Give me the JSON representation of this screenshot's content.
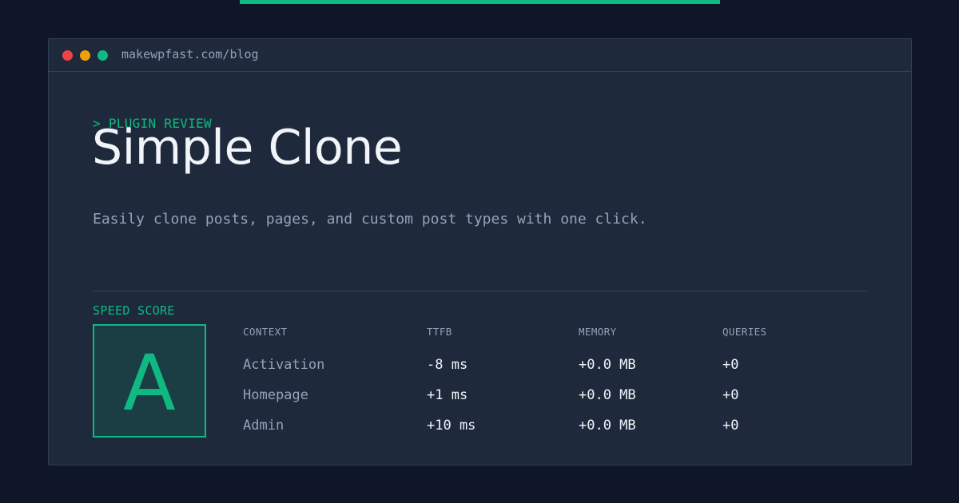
{
  "colors": {
    "accent": "#10b981",
    "background": "#0e1628",
    "panel": "#1e293b",
    "dot_red": "#ef4444",
    "dot_yellow": "#f59e0b",
    "dot_green": "#10b981"
  },
  "window": {
    "url": "makewpfast.com/blog"
  },
  "header": {
    "kicker": "> PLUGIN REVIEW",
    "title": "Simple Clone",
    "subtitle": "Easily clone posts, pages, and custom post types with one click."
  },
  "score": {
    "label": "SPEED SCORE",
    "grade": "A"
  },
  "metrics": {
    "columns": [
      "CONTEXT",
      "TTFB",
      "MEMORY",
      "QUERIES"
    ],
    "rows": [
      [
        "Activation",
        "-8 ms",
        "+0.0 MB",
        "+0"
      ],
      [
        "Homepage",
        "+1 ms",
        "+0.0 MB",
        "+0"
      ],
      [
        "Admin",
        "+10 ms",
        "+0.0 MB",
        "+0"
      ]
    ]
  }
}
